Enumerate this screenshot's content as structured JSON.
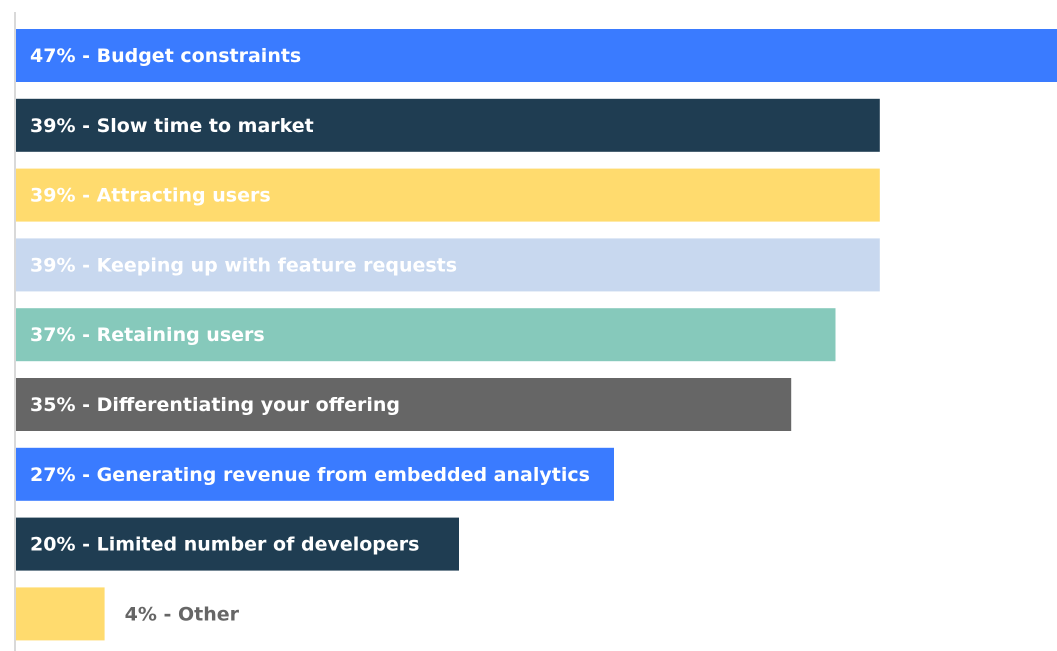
{
  "chart_data": {
    "type": "bar",
    "orientation": "horizontal",
    "title": "",
    "xlabel": "",
    "ylabel": "",
    "xlim": [
      0,
      47
    ],
    "grid": false,
    "legend": "none",
    "categories": [
      "Budget constraints",
      "Slow time to market",
      "Attracting users",
      "Keeping up with feature requests",
      "Retaining users",
      "Differentiating your offering",
      "Generating revenue from embedded analytics",
      "Limited number of developers",
      "Other"
    ],
    "values": [
      47,
      39,
      39,
      39,
      37,
      35,
      27,
      20,
      4
    ],
    "labels": [
      "47% - Budget constraints",
      "39% - Slow time to market",
      "39% - Attracting users",
      "39% - Keeping up with feature requests",
      "37% - Retaining users",
      "35% - Differentiating your offering",
      "27% - Generating revenue from embedded analytics",
      "20% - Limited number of developers",
      "4% - Other"
    ],
    "colors": [
      "#3a7bff",
      "#1f3d52",
      "#ffdb6e",
      "#c8d8ef",
      "#86c9bb",
      "#666666",
      "#3a7bff",
      "#1f3d52",
      "#ffdb6e"
    ],
    "label_colors": [
      "#ffffff",
      "#ffffff",
      "#ffffff",
      "#ffffff",
      "#ffffff",
      "#ffffff",
      "#ffffff",
      "#ffffff",
      "#666666"
    ]
  }
}
